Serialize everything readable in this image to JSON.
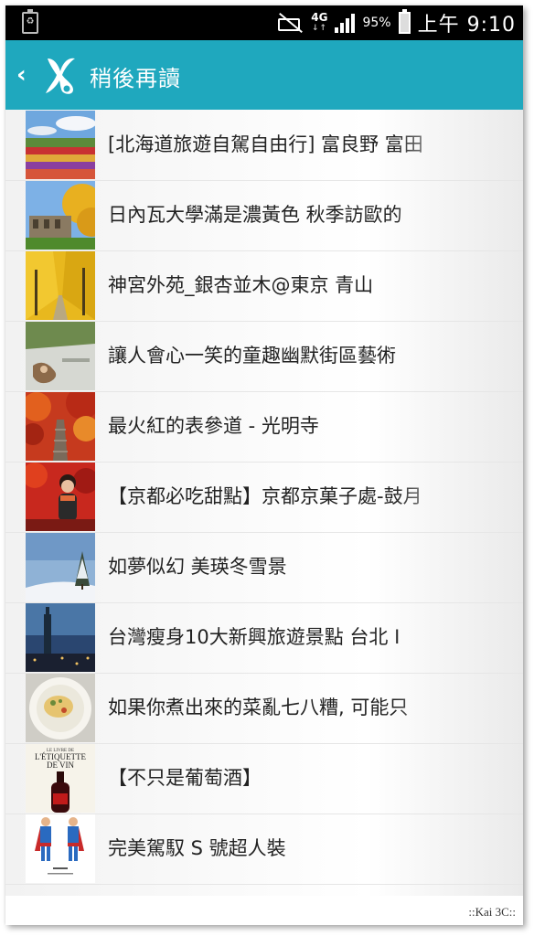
{
  "status_bar": {
    "network": "4G",
    "battery_percent": "95%",
    "time": "上午 9:10",
    "icons": [
      "recycle-icon",
      "mute-icon",
      "signal-icon",
      "battery-icon"
    ]
  },
  "app_bar": {
    "title": "稍後再讀",
    "back_icon": "chevron-left-icon",
    "logo_icon": "app-logo-icon",
    "color": "#1fa8be"
  },
  "articles": [
    {
      "title": "[北海道旅遊自駕自由行] 富良野 富田",
      "thumb": "flower-field"
    },
    {
      "title": "日內瓦大學滿是濃黃色  秋季訪歐的",
      "thumb": "autumn-building"
    },
    {
      "title": "神宮外苑_銀杏並木@東京 青山",
      "thumb": "ginkgo-avenue"
    },
    {
      "title": "讓人會心一笑的童趣幽默街區藝術",
      "thumb": "street-art"
    },
    {
      "title": "最火紅的表參道 - 光明寺",
      "thumb": "red-maple-steps"
    },
    {
      "title": "【京都必吃甜點】京都京菓子處-鼓月",
      "thumb": "woman-autumn"
    },
    {
      "title": "如夢似幻 美瑛冬雪景",
      "thumb": "snow-tree"
    },
    {
      "title": "台灣瘦身10大新興旅遊景點  台北 I",
      "thumb": "taipei-101"
    },
    {
      "title": "如果你煮出來的菜亂七八糟, 可能只",
      "thumb": "pasta-plate"
    },
    {
      "title": "【不只是葡萄酒】",
      "thumb": "wine-book",
      "thumb_text": [
        "LE LIVRE DE",
        "L'ÉTIQUETTE",
        "DE VIN"
      ]
    },
    {
      "title": "完美駕馭 S 號超人裝",
      "thumb": "superman-costumes"
    }
  ],
  "watermark": "::Kai 3C::"
}
